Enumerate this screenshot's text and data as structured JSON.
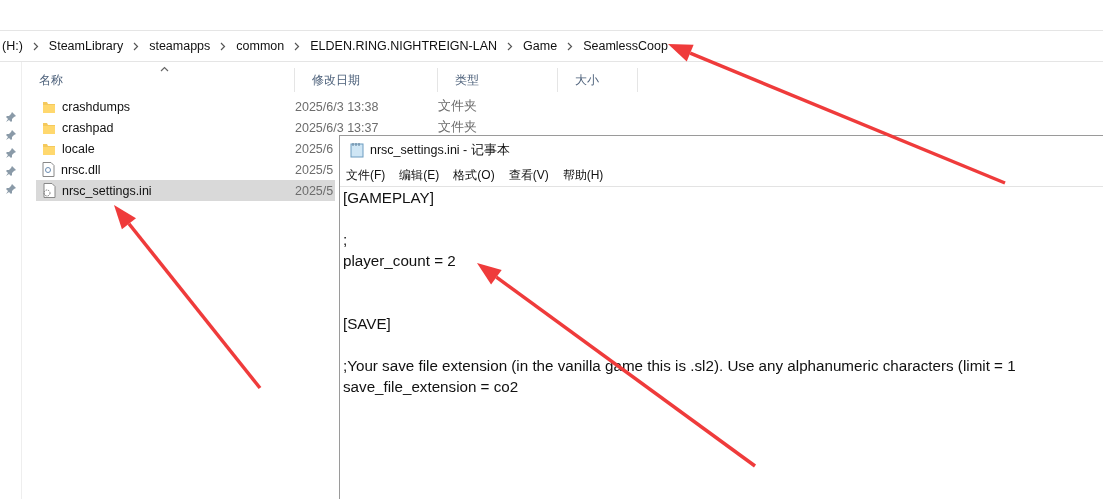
{
  "explorer": {
    "breadcrumb": [
      "(H:)",
      "SteamLibrary",
      "steamapps",
      "common",
      "ELDEN.RING.NIGHTREIGN-LAN",
      "Game",
      "SeamlessCoop"
    ],
    "columns": [
      "名称",
      "修改日期",
      "类型",
      "大小"
    ],
    "rows": [
      {
        "kind": "folder",
        "name": "crashdumps",
        "date": "2025/6/3 13:38",
        "type": "文件夹",
        "selected": false
      },
      {
        "kind": "folder",
        "name": "crashpad",
        "date": "2025/6/3 13:37",
        "type": "文件夹",
        "selected": false
      },
      {
        "kind": "folder",
        "name": "locale",
        "date": "2025/6",
        "selected": false
      },
      {
        "kind": "dll",
        "name": "nrsc.dll",
        "date": "2025/5",
        "selected": false
      },
      {
        "kind": "settings",
        "name": "nrsc_settings.ini",
        "date": "2025/5",
        "selected": true
      }
    ]
  },
  "notepad": {
    "title": "nrsc_settings.ini - 记事本",
    "menu": [
      "文件(F)",
      "编辑(E)",
      "格式(O)",
      "查看(V)",
      "帮助(H)"
    ],
    "lines": [
      {
        "kind": "text",
        "text": "[GAMEPLAY]"
      },
      {
        "kind": "blank"
      },
      {
        "kind": "text",
        "text": ";"
      },
      {
        "kind": "text",
        "text": "player_count = 2"
      },
      {
        "kind": "blank"
      },
      {
        "kind": "blank"
      },
      {
        "kind": "text",
        "text": "[SAVE]"
      },
      {
        "kind": "blank"
      },
      {
        "kind": "text",
        "text": ";Your save file extension (in the vanilla game this is .sl2). Use any alphanumeric characters (limit = 1"
      },
      {
        "kind": "text",
        "text": "save_file_extension = co2"
      }
    ]
  }
}
